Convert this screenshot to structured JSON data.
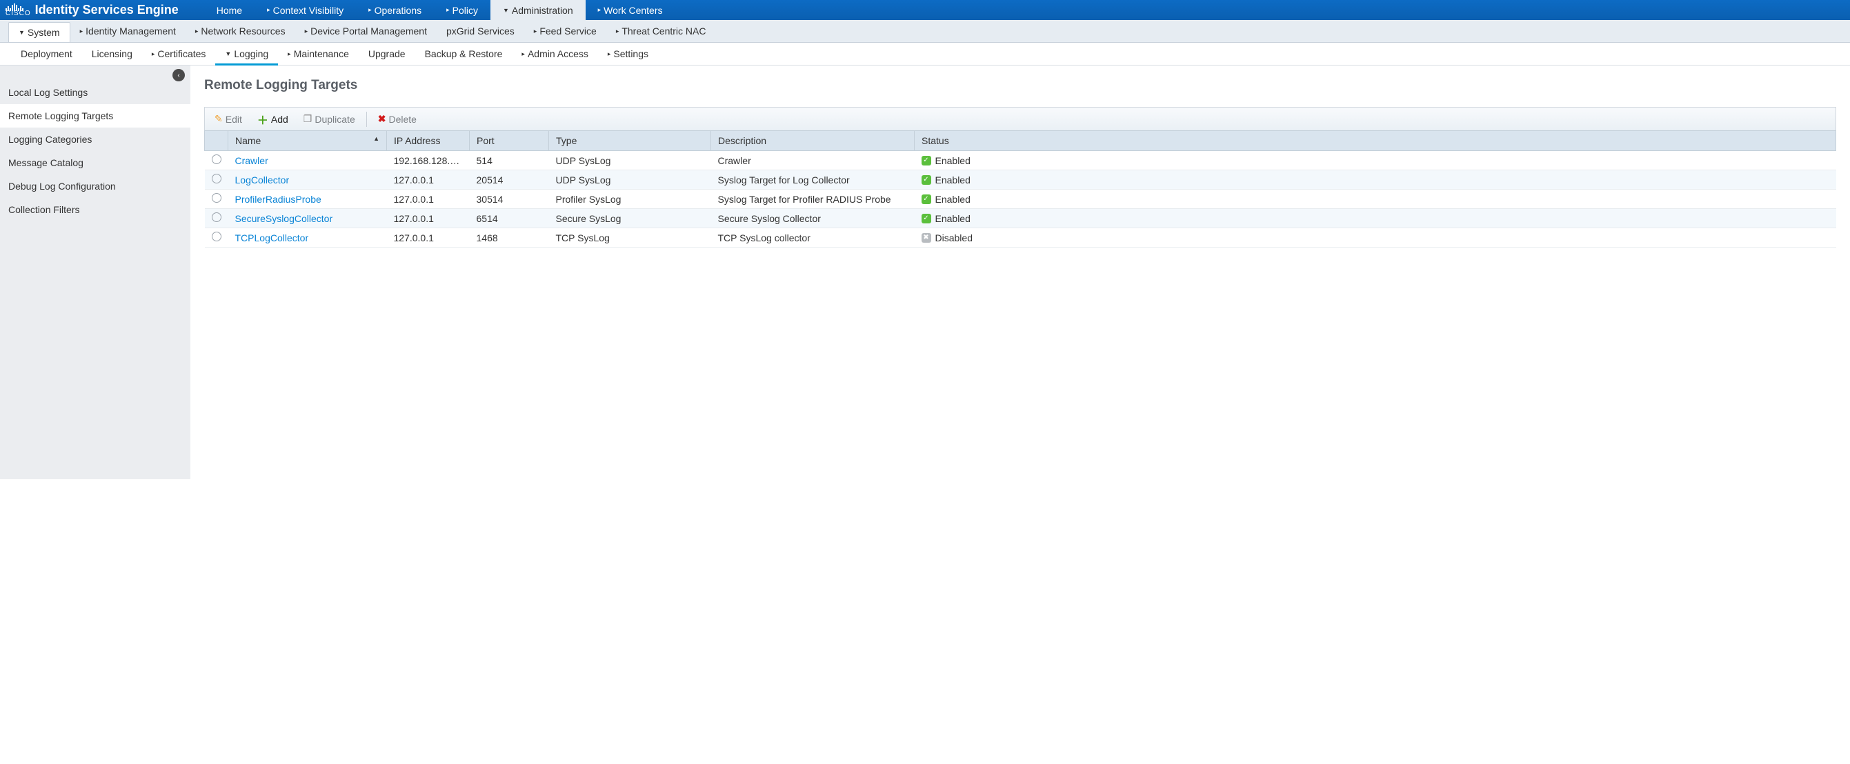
{
  "product_name": "Identity Services Engine",
  "logo_text": "CISCO",
  "topnav": [
    {
      "label": "Home",
      "caret": false
    },
    {
      "label": "Context Visibility",
      "caret": true
    },
    {
      "label": "Operations",
      "caret": true
    },
    {
      "label": "Policy",
      "caret": true
    },
    {
      "label": "Administration",
      "caret": true,
      "active": true,
      "caret_down": true
    },
    {
      "label": "Work Centers",
      "caret": true
    }
  ],
  "subnav": [
    {
      "label": "System",
      "caret": true,
      "active": true,
      "caret_down": true
    },
    {
      "label": "Identity Management",
      "caret": true
    },
    {
      "label": "Network Resources",
      "caret": true
    },
    {
      "label": "Device Portal Management",
      "caret": true
    },
    {
      "label": "pxGrid Services",
      "caret": false
    },
    {
      "label": "Feed Service",
      "caret": true
    },
    {
      "label": "Threat Centric NAC",
      "caret": true
    }
  ],
  "subsubnav": [
    {
      "label": "Deployment",
      "caret": false
    },
    {
      "label": "Licensing",
      "caret": false
    },
    {
      "label": "Certificates",
      "caret": true
    },
    {
      "label": "Logging",
      "caret": true,
      "active": true,
      "caret_down": true
    },
    {
      "label": "Maintenance",
      "caret": true
    },
    {
      "label": "Upgrade",
      "caret": false
    },
    {
      "label": "Backup & Restore",
      "caret": false
    },
    {
      "label": "Admin Access",
      "caret": true
    },
    {
      "label": "Settings",
      "caret": true
    }
  ],
  "sidebar": [
    {
      "label": "Local Log Settings"
    },
    {
      "label": "Remote Logging Targets",
      "active": true
    },
    {
      "label": "Logging Categories"
    },
    {
      "label": "Message Catalog"
    },
    {
      "label": "Debug Log Configuration"
    },
    {
      "label": "Collection Filters"
    }
  ],
  "page_title": "Remote Logging Targets",
  "toolbar": {
    "edit": "Edit",
    "add": "Add",
    "duplicate": "Duplicate",
    "delete": "Delete"
  },
  "columns": {
    "name": "Name",
    "ip": "IP Address",
    "port": "Port",
    "type": "Type",
    "description": "Description",
    "status": "Status"
  },
  "rows": [
    {
      "name": "Crawler",
      "ip": "192.168.128.…",
      "port": "514",
      "type": "UDP SysLog",
      "description": "Crawler",
      "status": "Enabled"
    },
    {
      "name": "LogCollector",
      "ip": "127.0.0.1",
      "port": "20514",
      "type": "UDP SysLog",
      "description": "Syslog Target for Log Collector",
      "status": "Enabled"
    },
    {
      "name": "ProfilerRadiusProbe",
      "ip": "127.0.0.1",
      "port": "30514",
      "type": "Profiler SysLog",
      "description": "Syslog Target for Profiler RADIUS Probe",
      "status": "Enabled"
    },
    {
      "name": "SecureSyslogCollector",
      "ip": "127.0.0.1",
      "port": "6514",
      "type": "Secure SysLog",
      "description": "Secure Syslog Collector",
      "status": "Enabled"
    },
    {
      "name": "TCPLogCollector",
      "ip": "127.0.0.1",
      "port": "1468",
      "type": "TCP SysLog",
      "description": "TCP SysLog collector",
      "status": "Disabled"
    }
  ]
}
